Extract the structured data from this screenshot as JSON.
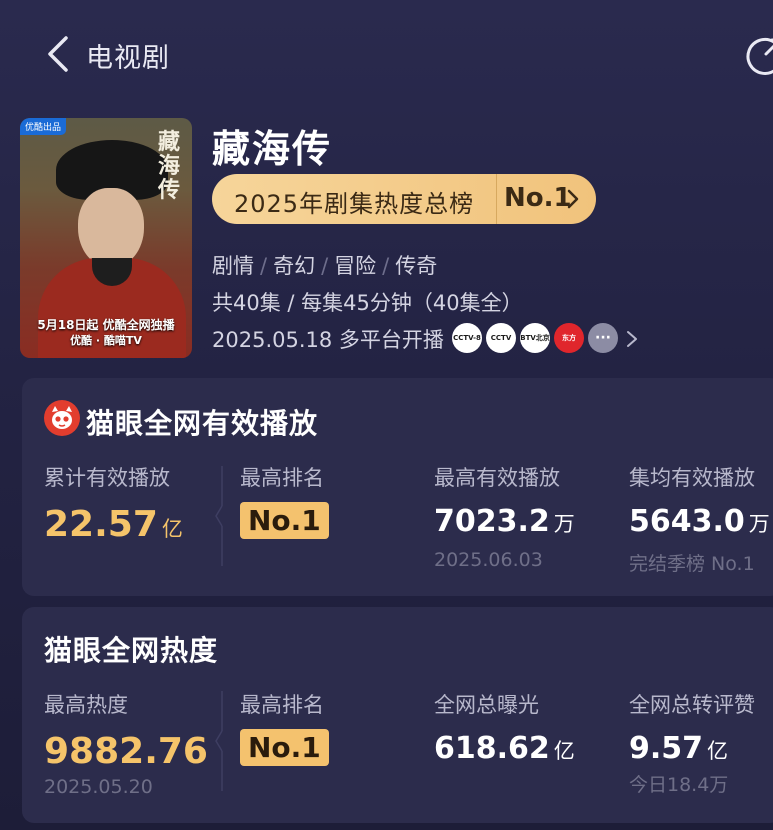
{
  "topbar": {
    "title": "电视剧"
  },
  "poster": {
    "tag": "优酷出品",
    "vertical_title": "藏海传",
    "date_text": "5月18日起 优酷全网独播",
    "logos_text": "优酷 · 酷喵TV"
  },
  "show": {
    "title": "藏海传",
    "rank_label": "2025年剧集热度总榜",
    "rank_value": "No.1",
    "genres": [
      "剧情",
      "奇幻",
      "冒险",
      "传奇"
    ],
    "episodes": "共40集 / 每集45分钟（40集全）",
    "airing": "2025.05.18 多平台开播",
    "platforms": [
      "CCTV-8",
      "CCTV",
      "BTV北京",
      "东方",
      "···"
    ]
  },
  "playback_card": {
    "title": "猫眼全网有效播放",
    "columns": [
      {
        "label": "累计有效播放",
        "value": "22.57",
        "unit": "亿",
        "sub": ""
      },
      {
        "label": "最高排名",
        "badge": "No.1"
      },
      {
        "label": "最高有效播放",
        "value": "7023.2",
        "unit": "万",
        "sub": "2025.06.03"
      },
      {
        "label": "集均有效播放",
        "value": "5643.0",
        "unit": "万",
        "sub": "完结季榜 No.1"
      }
    ]
  },
  "heat_card": {
    "title": "猫眼全网热度",
    "columns": [
      {
        "label": "最高热度",
        "value": "9882.76",
        "unit": "",
        "sub": "2025.05.20"
      },
      {
        "label": "最高排名",
        "badge": "No.1"
      },
      {
        "label": "全网总曝光",
        "value": "618.62",
        "unit": "亿",
        "sub": ""
      },
      {
        "label": "全网总转评赞",
        "value": "9.57",
        "unit": "亿",
        "sub": "今日18.4万"
      }
    ]
  },
  "colors": {
    "accent_gold": "#f5c46a",
    "background": "#232343",
    "card": "#2c2c4c"
  }
}
